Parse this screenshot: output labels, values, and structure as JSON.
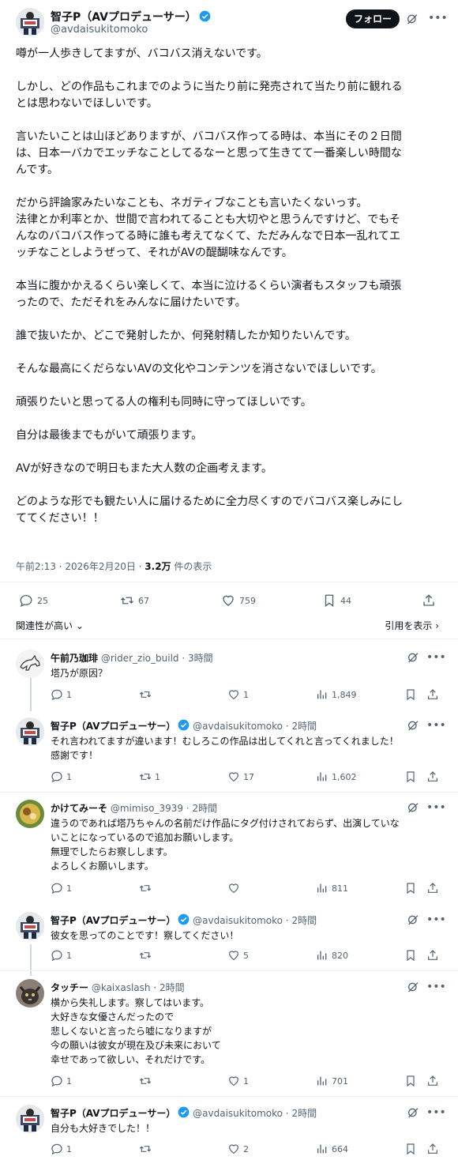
{
  "post": {
    "author_name": "智子P（AVプロデューサー）",
    "author_handle": "@avdaisukitomoko",
    "follow_label": "フォロー",
    "paragraphs": [
      "噂が一人歩きしてますが、バコバス消えないです。",
      "しかし、どの作品もこれまでのように当たり前に発売されて当たり前に観れる\nとは思わないでほしいです。",
      "言いたいことは山ほどありますが、バコバス作ってる時は、本当にその２日間\nは、日本一バカでエッチなことしてるなーと思って生きてて一番楽しい時間な\nんです。",
      "だから評論家みたいなことも、ネガティブなことも言いたくないっす。\n法律とか利率とか、世間で言われてることも大切やと思うんですけど、でもそ\nんなのバコバス作ってる時に誰も考えてなくて、ただみんなで日本一乱れてエ\nッチなことしようぜって、それがAVの醍醐味なんです。",
      "本当に腹かかえるくらい楽しくて、本当に泣けるくらい演者もスタッフも頑張\nったので、ただそれをみんなに届けたいです。",
      "誰で抜いたか、どこで発射したか、何発射精したか知りたいんです。",
      "そんな最高にくだらないAVの文化やコンテンツを消さないでほしいです。",
      "頑張りたいと思ってる人の権利も同時に守ってほしいです。",
      "自分は最後までもがいて頑張ります。",
      "AVが好きなので明日もまた大人数の企画考えます。",
      "どのような形でも観たい人に届けるために全力尽くすのでバコバス楽しみにし\nててください！！"
    ],
    "time": "午前2:13 · 2026年2月20日 · ",
    "views_count": "3.2万",
    "views_label": " 件の表示",
    "replies": "25",
    "reposts": "67",
    "likes": "759",
    "bookmarks": "44",
    "sort_label": "関連性が高い ⌄",
    "quotes_label": "引用を表示 ›"
  },
  "replies": [
    {
      "name": "午前乃珈琲",
      "handle": "@rider_zio_build",
      "time": "3時間",
      "text": "塔乃が原因？",
      "replies": "1",
      "reposts": "",
      "likes": "1",
      "views": "1,849",
      "avatar": "horse"
    },
    {
      "name": "智子P（AVプロデューサー）",
      "handle": "@avdaisukitomoko",
      "time": "2時間",
      "text": "それ言われてますが違います！むしろこの作品は出してくれと言ってくれました！\n感謝です！",
      "replies": "1",
      "reposts": "1",
      "likes": "17",
      "views": "1,602",
      "avatar": "tomoko"
    },
    {
      "name": "かけてみーそ",
      "handle": "@mimiso_3939",
      "time": "2時間",
      "text": "違うのであれば塔乃ちゃんの名前だけ作品にタグ付けされておらず、出演していな\nいことになっているので追加お願いします。\n無理でしたらお察しします。\nよろしくお願いします。",
      "replies": "1",
      "reposts": "",
      "likes": "",
      "views": "811",
      "avatar": "food"
    },
    {
      "name": "智子P（AVプロデューサー）",
      "handle": "@avdaisukitomoko",
      "time": "2時間",
      "text": "彼女を思ってのことです！察してください！",
      "replies": "1",
      "reposts": "",
      "likes": "5",
      "views": "820",
      "avatar": "tomoko"
    },
    {
      "name": "タッチー",
      "handle": "@kaixaslash",
      "time": "2時間",
      "text": "横から失礼します。察してはいます。\n大好きな女優さんだったので\n悲しくないと言ったら嘘になりますが\n今の願いは彼女が現在及び未来において\n幸せであって欲しい、それだけです。",
      "replies": "1",
      "reposts": "",
      "likes": "1",
      "views": "701",
      "avatar": "cat"
    },
    {
      "name": "智子P（AVプロデューサー）",
      "handle": "@avdaisukitomoko",
      "time": "2時間",
      "text": "自分も大好きでした！！",
      "replies": "1",
      "reposts": "",
      "likes": "2",
      "views": "664",
      "avatar": "tomoko"
    }
  ],
  "colors": {
    "text": "#0f1419",
    "muted": "#536471",
    "verified": "#1d9bf0",
    "divider": "#eff3f4"
  }
}
